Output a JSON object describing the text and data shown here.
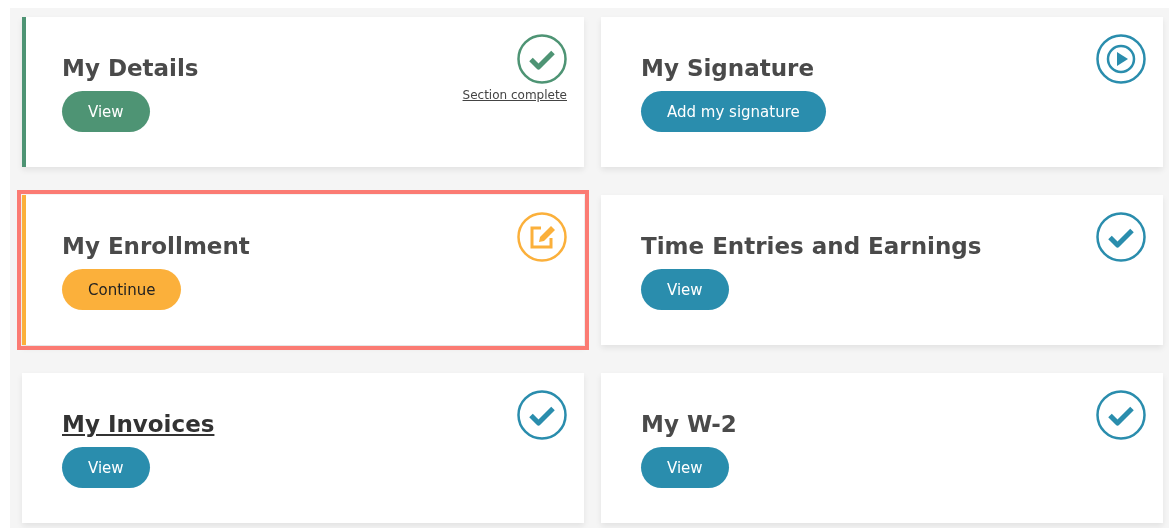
{
  "cards": [
    {
      "title": "My Details",
      "title_underlined": false,
      "button": "View",
      "kind": "complete",
      "note": "Section complete",
      "highlighted": false
    },
    {
      "title": "My Signature",
      "title_underlined": false,
      "button": "Add my signature",
      "kind": "not_started",
      "highlighted": false
    },
    {
      "title": "My Enrollment",
      "title_underlined": false,
      "button": "Continue",
      "kind": "in_progress",
      "highlighted": true
    },
    {
      "title": "Time Entries and Earnings",
      "title_underlined": false,
      "button": "View",
      "kind": "available",
      "highlighted": false
    },
    {
      "title": "My Invoices",
      "title_underlined": true,
      "button": "View",
      "kind": "available",
      "highlighted": false
    },
    {
      "title": "My W-2",
      "title_underlined": false,
      "button": "View",
      "kind": "available",
      "highlighted": false
    }
  ]
}
